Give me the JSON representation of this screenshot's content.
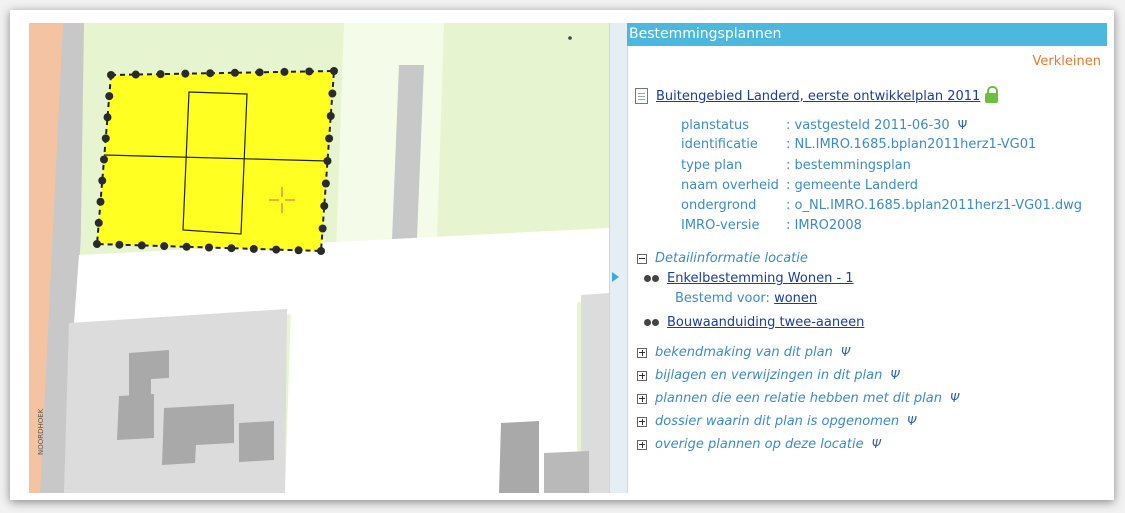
{
  "panel": {
    "header_title": "Bestemmingsplannen",
    "verkleinen_label": "Verkleinen",
    "plan_title": "Buitengebied Landerd, eerste ontwikkelplan 2011",
    "properties": [
      {
        "label": "planstatus",
        "value": ": vastgesteld 2011-06-30",
        "has_info_icon": true
      },
      {
        "label": "identificatie",
        "value": ": NL.IMRO.1685.bplan2011herz1-VG01",
        "has_info_icon": false
      },
      {
        "label": "type plan",
        "value": ": bestemmingsplan",
        "has_info_icon": false
      },
      {
        "label": "naam overheid",
        "value": ": gemeente Landerd",
        "has_info_icon": false
      },
      {
        "label": "ondergrond",
        "value": ": o_NL.IMRO.1685.bplan2011herz1-VG01.dwg",
        "has_info_icon": false
      },
      {
        "label": "IMRO-versie",
        "value": ": IMRO2008",
        "has_info_icon": false
      }
    ],
    "detail_section_label": "Detailinformatie locatie",
    "bestemming_1": "Enkelbestemming Wonen - 1",
    "bestemd_voor_label": "Bestemd voor:",
    "bestemd_voor_value": "wonen",
    "bestemming_2": "Bouwaanduiding twee-aaneen",
    "sections": [
      "bekendmaking van dit plan",
      "bijlagen en verwijzingen in dit plan",
      "plannen die een relatie hebben met dit plan",
      "dossier waarin dit plan is opgenomen",
      "overige plannen op deze locatie"
    ]
  },
  "map": {
    "street_label": "NOORDHOEK",
    "colors": {
      "parcel_fill": "#ffff22",
      "green_zone": "#e6f5d0",
      "road": "#ffffff",
      "buildings": "#d8d8d8",
      "street_orange": "#f4c4a2",
      "cross_marker": "#e8783a"
    }
  },
  "icons": {
    "document": "document-icon",
    "lock": "lock-icon",
    "info": "info-icon",
    "binoculars": "binoculars-icon",
    "expand": "plus-box-icon",
    "collapse": "minus-box-icon"
  }
}
